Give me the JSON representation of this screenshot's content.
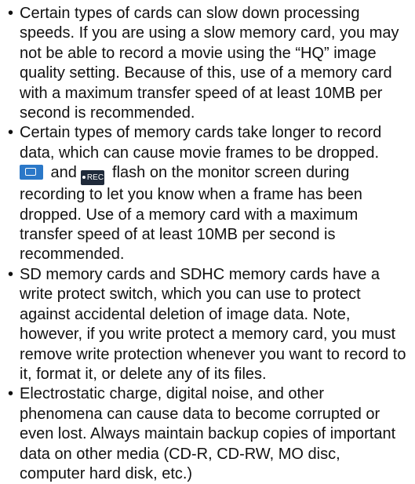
{
  "bullets": [
    {
      "text": "Certain types of cards can slow down processing speeds. If you are using a slow memory card, you may not be able to record a movie using the “HQ” image quality setting. Because of this, use of a memory card with a maximum transfer speed of at least 10MB per second is recommended."
    },
    {
      "text_before_icon": "",
      "icon_and": " and ",
      "icon2_label": "REC",
      "text_after": " flash on the monitor screen during recording to let you know when a frame has been dropped. Use of a memory card with a maximum transfer speed of at least 10MB per second is recommended.",
      "lead": "Certain types of memory cards take longer to record data, which can cause movie frames to be dropped. "
    },
    {
      "text": "SD memory cards and SDHC memory cards have a write protect switch, which you can use to protect against accidental deletion of image data. Note, however, if you write protect a memory card, you must remove write protection whenever you want to record to it, format it, or delete any of its files."
    },
    {
      "text": "Electrostatic charge, digital noise, and other phenomena can cause data to become corrupted or even lost. Always maintain backup copies of important data on other media (CD-R, CD-RW, MO disc, computer hard disk, etc.)"
    }
  ],
  "bullet_symbol": "•",
  "icons": {
    "card_icon": "memory-card-icon",
    "rec_icon": "rec-icon",
    "card_color": "#2b78c8",
    "rec_color": "#1f2a3a"
  }
}
